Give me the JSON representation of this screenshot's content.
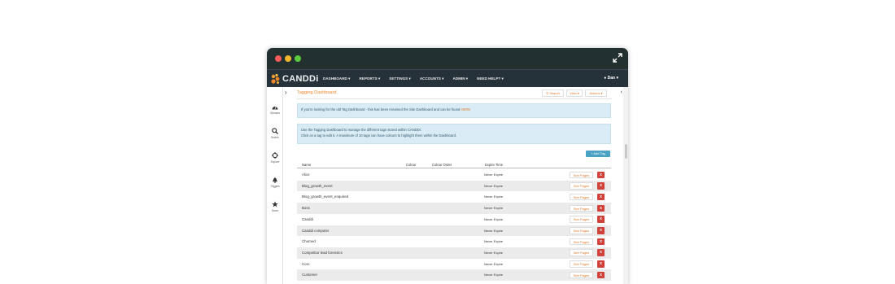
{
  "navbar": {
    "logo_text": "CANDDi",
    "menu": [
      "DASHBOARD",
      "REPORTS",
      "SETTINGS",
      "ACCOUNTS",
      "ADMIN",
      "NEED HELP?"
    ],
    "user": "Dan"
  },
  "sidebar": {
    "items": [
      {
        "label": "Streams",
        "icon": "dashboard-gauge-icon"
      },
      {
        "label": "Search",
        "icon": "search-icon"
      },
      {
        "label": "Explore",
        "icon": "crosshair-icon"
      },
      {
        "label": "Triggers",
        "icon": "bell-icon"
      },
      {
        "label": "Score",
        "icon": "star-icon"
      }
    ]
  },
  "header": {
    "title": "Tagging Dashboard",
    "search_label": "Search",
    "view_label": "View",
    "actions_label": "Actions"
  },
  "alerts": {
    "old_dashboard": "If you're looking for the old Tag Dashboard - this has been renamed the Site Dashboard and can be found",
    "old_dashboard_link": "HERE",
    "instructions_line1": "Use the Tagging Dashboard to manage the different tags stored within CANDDi.",
    "instructions_line2": "Click on a tag to edit it. A maximum of 10 tags can have colours to highlight them within the Dashboard."
  },
  "add_tag_label": "+ Add Tag",
  "table": {
    "columns": [
      "Name",
      "Colour",
      "Colour Order",
      "Expire Time"
    ],
    "see_pages_label": "See Pages",
    "delete_label": "x",
    "rows": [
      {
        "name": "Alice",
        "expiry": "Never Expire"
      },
      {
        "name": "Blog_growth_event",
        "expiry": "Never Expire"
      },
      {
        "name": "Blog_growth_event_enquired",
        "expiry": "Never Expire"
      },
      {
        "name": "Boss",
        "expiry": "Never Expire"
      },
      {
        "name": "Canddi",
        "expiry": "Never Expire"
      },
      {
        "name": "Canddi computer",
        "expiry": "Never Expire"
      },
      {
        "name": "Churned",
        "expiry": "Never Expire"
      },
      {
        "name": "Competitor lead forensics",
        "expiry": "Never Expire"
      },
      {
        "name": "Core",
        "expiry": "Never Expire"
      },
      {
        "name": "Customer",
        "expiry": "Never Expire"
      }
    ]
  },
  "colors": {
    "accent": "#f0862c",
    "navbar": "#26323a",
    "titlebar": "#22302f",
    "danger": "#d0413a",
    "info_button": "#4aa3c4"
  }
}
